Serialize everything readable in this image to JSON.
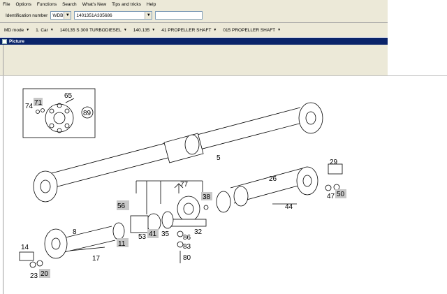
{
  "menu": [
    "File",
    "Options",
    "Functions",
    "Search",
    "What's New",
    "Tips and tricks",
    "Help"
  ],
  "id_bar": {
    "label": "Identification number",
    "prefix": "WDB",
    "value": "1401351A335686"
  },
  "nav": [
    "MD mode",
    "1. Car",
    "140135 S 300 TURBODIESEL",
    "140.135",
    "41 PROPELLER SHAFT",
    "015 PROPELLER SHAFT"
  ],
  "panel_title": "Picture",
  "callouts": {
    "c65": "65",
    "c71": "71",
    "c74": "74",
    "c89": "89",
    "c5": "5",
    "c77": "77",
    "c56": "56",
    "c38": "38",
    "c26": "26",
    "c29": "29",
    "c47": "47",
    "c50": "50",
    "c44": "44",
    "c8": "8",
    "c11": "11",
    "c53": "53",
    "c41": "41",
    "c35": "35",
    "c32": "32",
    "c86": "86",
    "c83": "83",
    "c80": "80",
    "c17": "17",
    "c14": "14",
    "c23": "23",
    "c20": "20"
  }
}
